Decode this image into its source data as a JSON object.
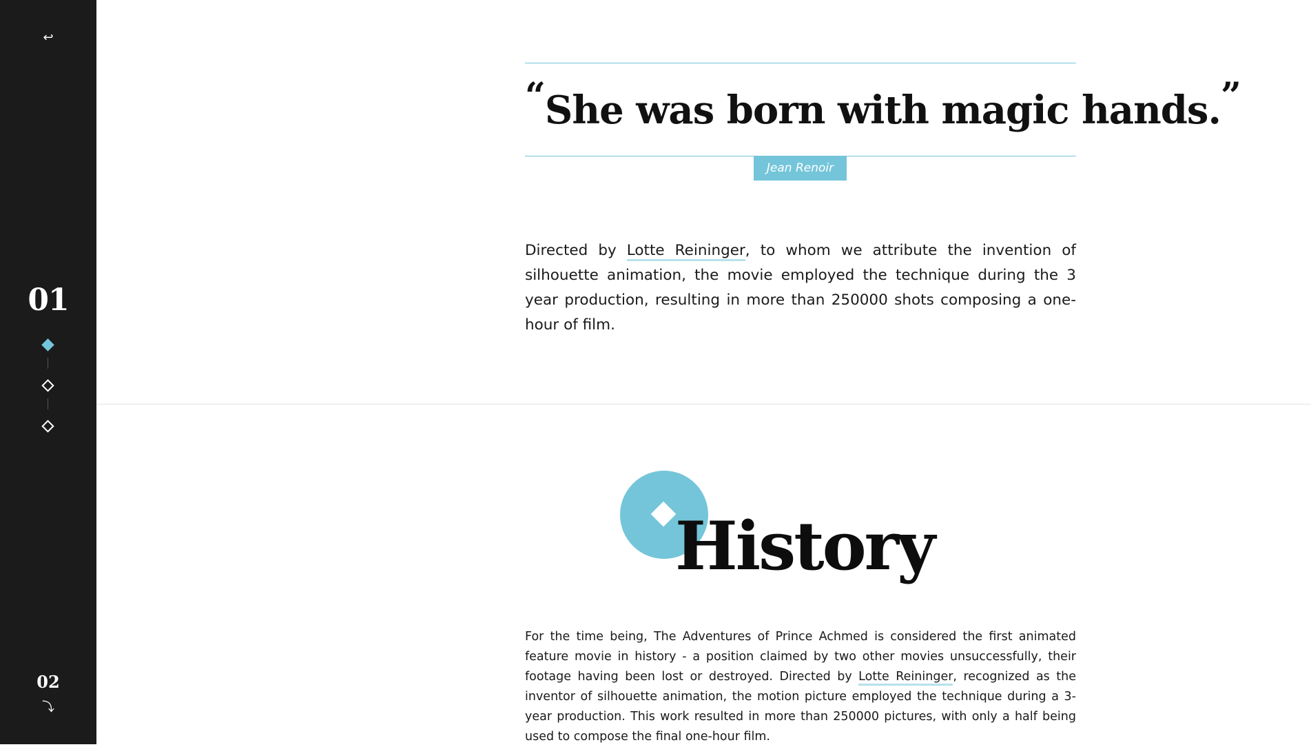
{
  "sidebar": {
    "back_icon": "↩",
    "chapter_current": "01",
    "chapter_next": "02",
    "next_icon": "⤵",
    "accent_color": "#74c5d9",
    "background_color": "#1b1b1b"
  },
  "quote": {
    "open_mark": "“",
    "text": "She was born with magic hands.",
    "close_mark": "”",
    "author": "Jean Renoir"
  },
  "lead": {
    "before_link": "Directed by ",
    "link_text": "Lotte Reininger",
    "after_link": ", to whom we attribute the invention of silhouette animation, the movie employed the technique during the 3 year production, resulting in more than 250000 shots composing a one-hour of film."
  },
  "history": {
    "heading": "History",
    "before_link": "For the time being, The Adventures of Prince Achmed is considered the first animated feature movie in history - a position claimed by two other movies unsuccessfully, their footage having been lost or destroyed. Directed by ",
    "link_text": "Lotte Reininger",
    "after_link": ", recognized as the inventor of silhouette animation, the motion picture employed the technique during a 3-year production. This work resulted in more than 250000 pictures, with only a half being used to compose the final one-hour film."
  }
}
